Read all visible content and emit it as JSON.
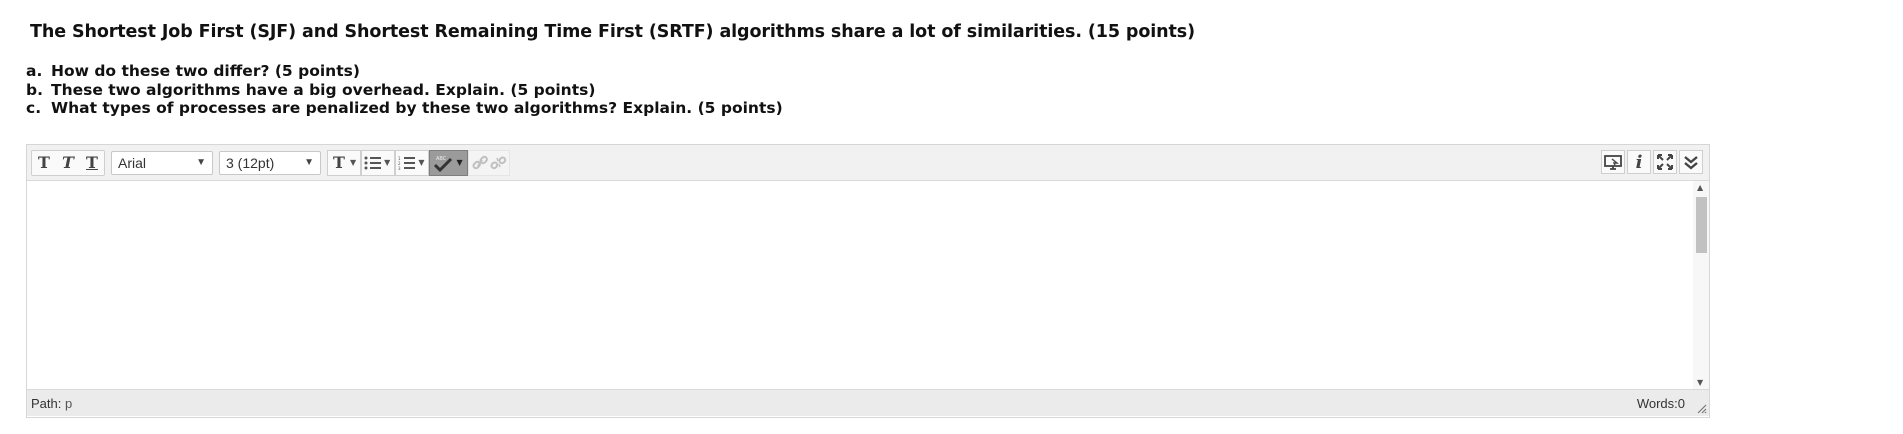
{
  "question": {
    "title": "The Shortest Job First (SJF) and Shortest Remaining Time First (SRTF) algorithms share a lot of similarities. (15 points)",
    "parts": [
      {
        "letter": "a.",
        "text": "How do these two differ? (5 points)"
      },
      {
        "letter": "b.",
        "text": "These two algorithms have a big overhead. Explain. (5 points)"
      },
      {
        "letter": "c.",
        "text": "What types of processes are penalized by these two algorithms? Explain. (5 points)"
      }
    ]
  },
  "editor": {
    "toolbar": {
      "font_family": "Arial",
      "font_size": "3 (12pt)",
      "text_style_glyph": "T",
      "icons": [
        "bold-icon",
        "italic-icon",
        "underline-icon",
        "text-color-icon",
        "bullet-list-icon",
        "numbered-list-icon",
        "spellcheck-icon",
        "link-icon",
        "unlink-icon",
        "preview-icon",
        "info-icon",
        "fullscreen-icon",
        "more-icon"
      ]
    },
    "content": "",
    "status": {
      "path_label": "Path:",
      "path_value": "p",
      "words_label": "Words:0"
    }
  },
  "colors": {
    "toolbar_bg": "#f1f1f1",
    "status_bg": "#ebebeb",
    "spell_active": "#9b9b9b"
  }
}
